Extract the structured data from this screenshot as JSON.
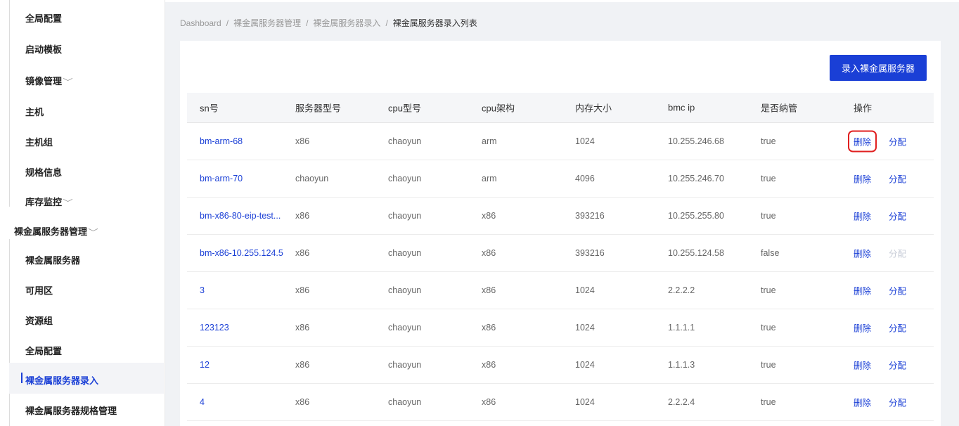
{
  "sidebar": {
    "items": [
      {
        "label": "全局配置"
      },
      {
        "label": "启动模板"
      },
      {
        "label": "镜像管理"
      },
      {
        "label": "主机"
      },
      {
        "label": "主机组"
      },
      {
        "label": "规格信息"
      },
      {
        "label": "库存监控"
      },
      {
        "label": "裸金属服务器管理"
      },
      {
        "label": "裸金属服务器"
      },
      {
        "label": "可用区"
      },
      {
        "label": "资源组"
      },
      {
        "label": "全局配置"
      },
      {
        "label": "裸金属服务器录入"
      },
      {
        "label": "裸金属服务器规格管理"
      }
    ],
    "chevron": "﹀"
  },
  "breadcrumb": {
    "items": [
      "Dashboard",
      "裸金属服务器管理",
      "裸金属服务器录入",
      "裸金属服务器录入列表"
    ],
    "separator": "/"
  },
  "toolbar": {
    "add_label": "录入裸金属服务器"
  },
  "table": {
    "headers": [
      "sn号",
      "服务器型号",
      "cpu型号",
      "cpu架构",
      "内存大小",
      "bmc ip",
      "是否纳管",
      "操作"
    ],
    "actions": {
      "delete": "删除",
      "assign": "分配"
    },
    "rows": [
      {
        "sn": "bm-arm-68",
        "model": "x86",
        "cpu": "chaoyun",
        "arch": "arm",
        "memory": "1024",
        "bmc_ip": "10.255.246.68",
        "managed": "true"
      },
      {
        "sn": "bm-arm-70",
        "model": "chaoyun",
        "cpu": "chaoyun",
        "arch": "arm",
        "memory": "4096",
        "bmc_ip": "10.255.246.70",
        "managed": "true"
      },
      {
        "sn": "bm-x86-80-eip-test...",
        "model": "x86",
        "cpu": "chaoyun",
        "arch": "x86",
        "memory": "393216",
        "bmc_ip": "10.255.255.80",
        "managed": "true"
      },
      {
        "sn": "bm-x86-10.255.124.5",
        "model": "x86",
        "cpu": "chaoyun",
        "arch": "x86",
        "memory": "393216",
        "bmc_ip": "10.255.124.58",
        "managed": "false"
      },
      {
        "sn": "3",
        "model": "x86",
        "cpu": "chaoyun",
        "arch": "x86",
        "memory": "1024",
        "bmc_ip": "2.2.2.2",
        "managed": "true"
      },
      {
        "sn": "123123",
        "model": "x86",
        "cpu": "chaoyun",
        "arch": "x86",
        "memory": "1024",
        "bmc_ip": "1.1.1.1",
        "managed": "true"
      },
      {
        "sn": "12",
        "model": "x86",
        "cpu": "chaoyun",
        "arch": "x86",
        "memory": "1024",
        "bmc_ip": "1.1.1.3",
        "managed": "true"
      },
      {
        "sn": "4",
        "model": "x86",
        "cpu": "chaoyun",
        "arch": "x86",
        "memory": "1024",
        "bmc_ip": "2.2.2.4",
        "managed": "true"
      }
    ]
  },
  "colors": {
    "primary": "#1a3fd6",
    "highlight_box": "#e02020",
    "disabled": "#c8cdd8"
  }
}
